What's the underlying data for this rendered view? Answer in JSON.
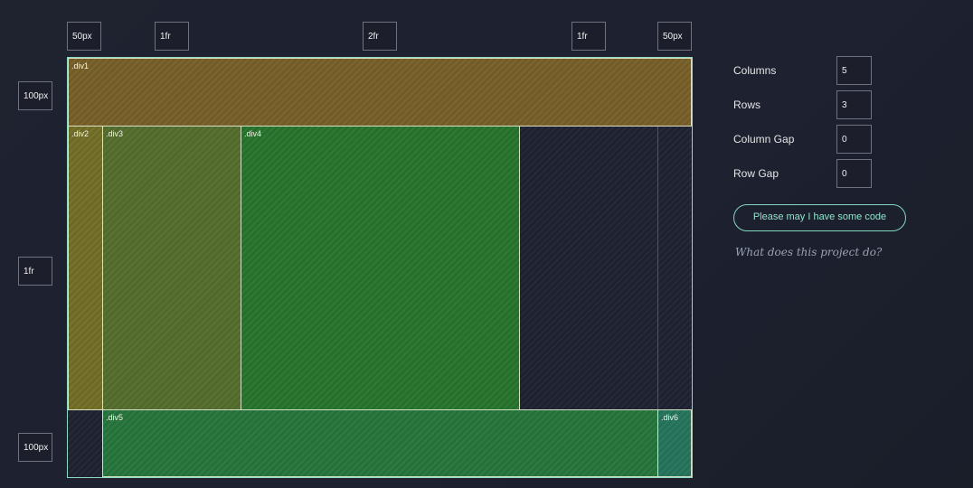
{
  "column_tracks": [
    "50px",
    "1fr",
    "2fr",
    "1fr",
    "50px"
  ],
  "row_tracks": [
    "100px",
    "1fr",
    "100px"
  ],
  "grid_items": [
    {
      "label": ".div1",
      "color": "#735b25"
    },
    {
      "label": ".div2",
      "color": "#6e6a24"
    },
    {
      "label": ".div3",
      "color": "#51692a"
    },
    {
      "label": ".div4",
      "color": "#24702a"
    },
    {
      "label": ".div5",
      "color": "#237138"
    },
    {
      "label": ".div6",
      "color": "#217057"
    }
  ],
  "controls": {
    "columns": {
      "label": "Columns",
      "value": "5"
    },
    "rows": {
      "label": "Rows",
      "value": "3"
    },
    "column_gap": {
      "label": "Column Gap",
      "value": "0"
    },
    "row_gap": {
      "label": "Row Gap",
      "value": "0"
    }
  },
  "code_button_label": "Please may I have some code",
  "project_link": "What does this project do?",
  "colors": {
    "grid_border": "#8cd9c4",
    "accent": "#7fd9c0",
    "background": "#1e2130"
  }
}
